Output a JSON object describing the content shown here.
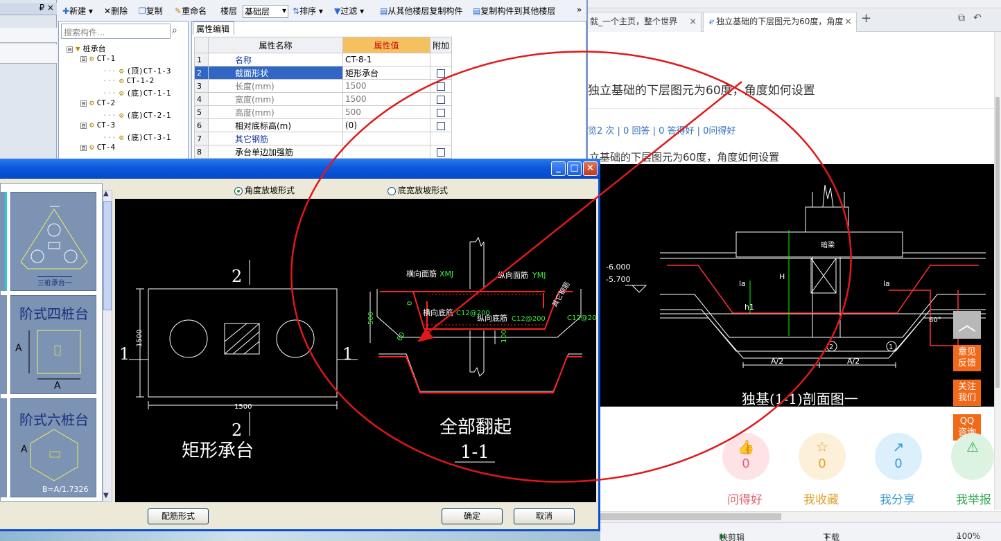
{
  "browser": {
    "tabs": [
      {
        "label": "就_一个主页，整个世界",
        "close": "×"
      },
      {
        "label": "独立基础的下层图元为60度，角度",
        "close": "×"
      }
    ],
    "new_tab": "+",
    "question_title": "独立基础的下层图元为60度，角度如何设置",
    "question_stats": "览2 次 | 0 回答 | 0 答得好 | 0问得好",
    "question_body": "立基础的下层图元为60度，角度如何设置",
    "side": {
      "top": "︿",
      "feedback": "意见\n反馈",
      "follow": "关注\n我们",
      "qq": "QQ\n咨询"
    },
    "actions": [
      {
        "icon": "👍",
        "count": "0",
        "label": "问得好",
        "color": "#e0606e",
        "bg": "#fde3e6"
      },
      {
        "icon": "☆",
        "count": "0",
        "label": "我收藏",
        "color": "#e0a030",
        "bg": "#fdf0d8"
      },
      {
        "icon": "↗",
        "count": "0",
        "label": "我分享",
        "color": "#3a9ad8",
        "bg": "#dcf0fb"
      },
      {
        "icon": "⚠",
        "count": "",
        "label": "我举报",
        "color": "#34a853",
        "bg": "#dcf3e2"
      }
    ],
    "status": {
      "clip": "快剪辑",
      "download": "下载",
      "zoom": "100%"
    }
  },
  "cad2": {
    "elev1": "-6.000",
    "elev2": "-5.700",
    "col_label": "暗梁",
    "side_label": "其他钢筋",
    "la": "la",
    "h": "H",
    "h1": "h1",
    "a2": "A/2",
    "angle": "60°",
    "c1": "1",
    "c2": "2",
    "caption": "独基(1-1)剖面图一"
  },
  "app": {
    "left_pin": "₽ ×",
    "toolbar": {
      "new": "新建",
      "delete": "删除",
      "copy": "复制",
      "rename": "重命名",
      "floor": "楼层",
      "base_floor": "基础层",
      "sort": "排序",
      "filter": "过滤",
      "copy_from": "从其他楼层复制构件",
      "copy_to": "复制构件到其他楼层",
      "more": "»"
    },
    "search_placeholder": "搜索构件...",
    "tree": [
      {
        "label": "桩承台",
        "level": 0,
        "box": "⊟"
      },
      {
        "label": "CT-1",
        "level": 1,
        "box": "⊟"
      },
      {
        "label": "(顶)CT-1-3",
        "level": 2
      },
      {
        "label": "CT-1-2",
        "level": 2
      },
      {
        "label": "(底)CT-1-1",
        "level": 2
      },
      {
        "label": "CT-2",
        "level": 1,
        "box": "⊟"
      },
      {
        "label": "(底)CT-2-1",
        "level": 2
      },
      {
        "label": "CT-3",
        "level": 1,
        "box": "⊟"
      },
      {
        "label": "(底)CT-3-1",
        "level": 2
      },
      {
        "label": "CT-4",
        "level": 1,
        "box": "⊟"
      }
    ],
    "prop_tab": "属性编辑",
    "prop_headers": [
      "属性名称",
      "属性值",
      "附加"
    ],
    "props": [
      {
        "n": "1",
        "name": "名称",
        "value": "CT-8-1",
        "style": "blue",
        "check": false
      },
      {
        "n": "2",
        "name": "截面形状",
        "value": "矩形承台",
        "style": "sel",
        "check": true
      },
      {
        "n": "3",
        "name": "长度(mm)",
        "value": "1500",
        "style": "grey",
        "check": true
      },
      {
        "n": "4",
        "name": "宽度(mm)",
        "value": "1500",
        "style": "grey",
        "check": true
      },
      {
        "n": "5",
        "name": "高度(mm)",
        "value": "500",
        "style": "grey",
        "check": true
      },
      {
        "n": "6",
        "name": "相对底标高(m)",
        "value": "(0)",
        "style": "",
        "check": true
      },
      {
        "n": "7",
        "name": "其它钢筋",
        "value": "",
        "style": "blue",
        "check": false
      },
      {
        "n": "8",
        "name": "承台单边加强筋",
        "value": "",
        "style": "",
        "check": true
      }
    ]
  },
  "dialog": {
    "min": "_",
    "max": "□",
    "close": "×",
    "options": [
      {
        "label": "角度放坡形式",
        "selected": true
      },
      {
        "label": "底宽放坡形式",
        "selected": false
      }
    ],
    "thumbs": [
      {
        "title": "",
        "caption": "三桩承台一"
      },
      {
        "title": "阶式四桩台",
        "caption": ""
      },
      {
        "title": "阶式六桩台",
        "caption": "B=A/1.7326"
      }
    ],
    "thumb_letter": "A",
    "drawing": {
      "plan_dim_w": "1500",
      "plan_dim_h": "1500",
      "sec_1": "1",
      "sec_2": "2",
      "shape_name": "矩形承台",
      "heng_top": "横向面筋",
      "heng_top_code": "XMJ",
      "zong_top": "纵向面筋",
      "zong_top_code": "YMJ",
      "heng_bot": "横向底筋",
      "heng_bot_code": "C12@200",
      "zong_bot": "纵向底筋",
      "zong_bot_code": "C12@200",
      "side_code": "C12@200",
      "side_label": "其它钢筋",
      "depth": "500",
      "angle": "60",
      "bot_dim": "100",
      "zero": "0",
      "fan_label": "全部翻起",
      "section_label": "1-1"
    },
    "buttons": {
      "rebar": "配筋形式",
      "ok": "确定",
      "cancel": "取消"
    }
  }
}
